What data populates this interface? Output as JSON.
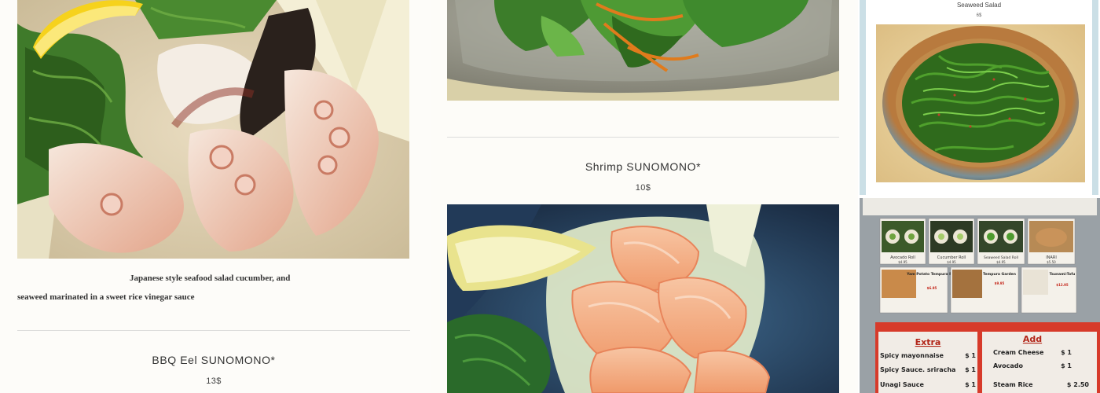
{
  "items": [
    {
      "description_line1": "Japanese style seafood salad cucumber, and",
      "description_line2": "seaweed marinated in a sweet rice vinegar sauce"
    },
    {
      "title": "BBQ Eel SUNOMONO*",
      "price": "13$"
    },
    {
      "title": "Shrimp SUNOMONO*",
      "price": "10$"
    }
  ],
  "sidebar_card": {
    "title": "Seaweed Salad",
    "price": "6$"
  },
  "menu_photo": {
    "tiles": [
      {
        "name": "Avocado Roll",
        "price": "$4.95"
      },
      {
        "name": "Cucumber Roll",
        "price": "$4.95"
      },
      {
        "name": "Seaweed Salad Roll",
        "price": "$4.95"
      },
      {
        "name": "INARI",
        "price": "$5.50"
      },
      {
        "name": "Yam Potato Tempura Roll",
        "price": "$6.95"
      },
      {
        "name": "Tempura Garden",
        "price": "$9.95"
      },
      {
        "name": "Tsunami-Tofu",
        "price": "$12.95"
      }
    ],
    "extra": {
      "heading": "Extra",
      "rows": [
        {
          "label": "Spicy mayonnaise",
          "price": "$ 1"
        },
        {
          "label": "Spicy Sauce. sriracha",
          "price": "$ 1"
        },
        {
          "label": "Unagi Sauce",
          "price": "$ 1"
        }
      ]
    },
    "add": {
      "heading": "Add",
      "rows": [
        {
          "label": "Cream Cheese",
          "price": "$ 1"
        },
        {
          "label": "Avocado",
          "price": "$ 1"
        },
        {
          "label": "Steam Rice",
          "price": "$ 2.50"
        }
      ]
    }
  },
  "colors": {
    "background": "#fdfcf9",
    "divider": "#dcdcdc",
    "text": "#333333",
    "card_frame": "#cbdfe6",
    "menu_red": "#d73a2a"
  }
}
